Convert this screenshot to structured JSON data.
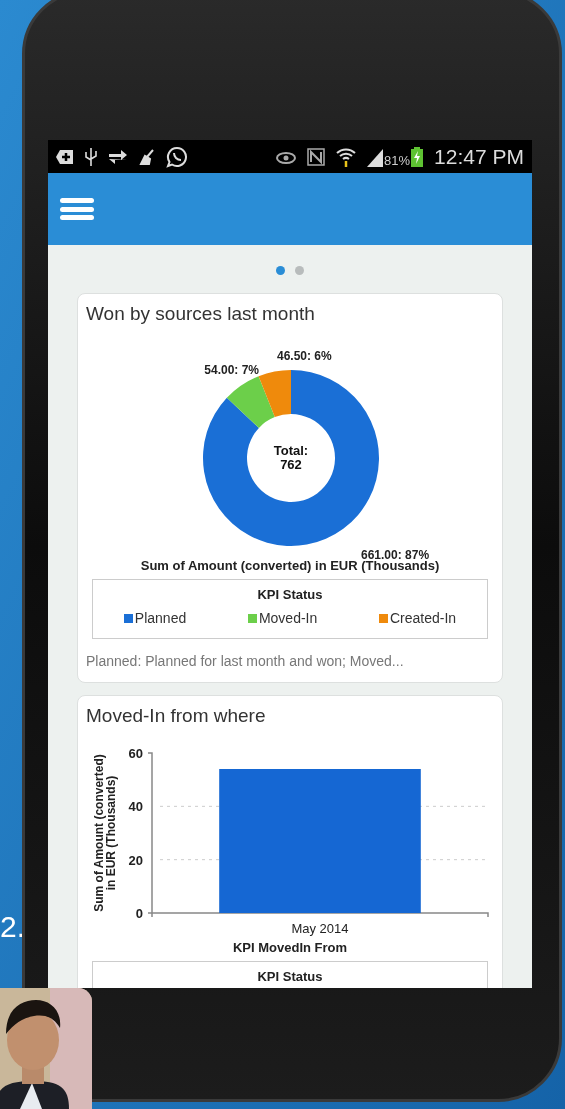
{
  "side_text": "2.",
  "status_bar": {
    "battery": "81%",
    "time": "12:47 PM"
  },
  "pager": [
    {
      "selected": true
    },
    {
      "selected": false
    }
  ],
  "cards": [
    {
      "title": "Won by sources last month",
      "chart_data": {
        "type": "donut",
        "categories": [
          "Planned",
          "Moved-In",
          "Created-In"
        ],
        "values": [
          87,
          7,
          6
        ],
        "colors": [
          "#1a6fd6",
          "#6ccf4a",
          "#ef8a0c"
        ],
        "value_labels": [
          "661.00: 87%",
          "54.00: 7%",
          "46.50: 6%"
        ],
        "annotations": [
          "Total:",
          "762"
        ],
        "xlabel": "Sum of Amount (converted) in EUR (Thousands)"
      },
      "legend": {
        "title": "KPI Status"
      },
      "footnote": "Planned: Planned for last month and won; Moved..."
    },
    {
      "title": "Moved-In from where",
      "chart_data": {
        "type": "bar",
        "categories": [
          "May 2014"
        ],
        "series": [
          {
            "color": "#1567d3",
            "values": [
              54
            ]
          }
        ],
        "ylim": [
          0,
          60
        ],
        "yticks": [
          0,
          20,
          40,
          60
        ],
        "ylabel": [
          "Sum of Amount (converted)",
          "in EUR (Thousands)"
        ],
        "xlabel": "KPI MovedIn From"
      },
      "legend": {
        "title": "KPI Status"
      }
    }
  ]
}
